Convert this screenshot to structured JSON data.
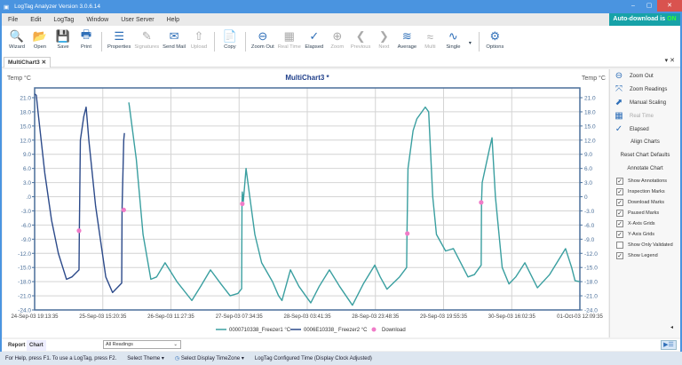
{
  "window": {
    "title": "LogTag Analyzer  Version 3.0.6.14",
    "minimize": "–",
    "maximize": "▢",
    "close": "✕"
  },
  "menu": [
    "File",
    "Edit",
    "LogTag",
    "Window",
    "User Server",
    "Help"
  ],
  "auto_download": {
    "label": "Auto-download is",
    "state": "ON"
  },
  "toolbar": [
    {
      "label": "Wizard",
      "icon": "wizard-icon",
      "glyph": "🔍",
      "enabled": true
    },
    {
      "label": "Open",
      "icon": "folder-open-icon",
      "glyph": "📂",
      "enabled": true
    },
    {
      "label": "Save",
      "icon": "save-icon",
      "glyph": "💾",
      "enabled": true
    },
    {
      "label": "Print",
      "icon": "printer-icon",
      "glyph": "🖶",
      "enabled": true
    },
    {
      "sep": true
    },
    {
      "label": "Properties",
      "icon": "properties-icon",
      "glyph": "☰",
      "enabled": true
    },
    {
      "label": "Signatures",
      "icon": "signature-icon",
      "glyph": "✎",
      "enabled": false
    },
    {
      "label": "Send Mail",
      "icon": "mail-icon",
      "glyph": "✉",
      "enabled": true
    },
    {
      "label": "Upload",
      "icon": "upload-icon",
      "glyph": "⇧",
      "enabled": false
    },
    {
      "sep": true
    },
    {
      "label": "Copy",
      "icon": "copy-icon",
      "glyph": "📄",
      "enabled": true
    },
    {
      "sep": true
    },
    {
      "label": "Zoom Out",
      "icon": "zoom-out-icon",
      "glyph": "⊖",
      "enabled": true
    },
    {
      "label": "Real Time",
      "icon": "calendar-icon",
      "glyph": "▦",
      "enabled": false
    },
    {
      "label": "Elapsed",
      "icon": "elapsed-icon",
      "glyph": "✓",
      "enabled": true
    },
    {
      "label": "Zoom",
      "icon": "zoom-in-icon",
      "glyph": "⊕",
      "enabled": false
    },
    {
      "label": "Previous",
      "icon": "previous-icon",
      "glyph": "❮",
      "enabled": false
    },
    {
      "label": "Next",
      "icon": "next-icon",
      "glyph": "❯",
      "enabled": false
    },
    {
      "label": "Average",
      "icon": "average-chart-icon",
      "glyph": "≋",
      "enabled": true
    },
    {
      "label": "Multi",
      "icon": "multi-chart-icon",
      "glyph": "≈",
      "enabled": false
    },
    {
      "label": "Single",
      "icon": "single-chart-icon",
      "glyph": "∿",
      "enabled": true
    },
    {
      "label": "▾",
      "icon": "dropdown-icon",
      "glyph": "",
      "enabled": true
    },
    {
      "sep": true
    },
    {
      "label": "Options",
      "icon": "gear-icon",
      "glyph": "⚙",
      "enabled": true
    }
  ],
  "doc_tab": {
    "label": "MultiChart3",
    "close": "✕"
  },
  "tab_controls": "▾ ✕",
  "right_panel": {
    "buttons": [
      {
        "label": "Zoom Out",
        "icon": "zoom-out-icon",
        "glyph": "⊖",
        "enabled": true
      },
      {
        "label": "Zoom Readings",
        "icon": "zoom-readings-icon",
        "glyph": "⤧",
        "enabled": true
      },
      {
        "label": "Manual Scaling",
        "icon": "manual-scaling-icon",
        "glyph": "⬈",
        "enabled": true
      },
      {
        "label": "Real Time",
        "icon": "calendar-icon",
        "glyph": "▦",
        "enabled": false
      },
      {
        "label": "Elapsed",
        "icon": "elapsed-icon",
        "glyph": "✓",
        "enabled": true
      }
    ],
    "actions": [
      "Align Charts",
      "Reset Chart Defaults",
      "Annotate Chart"
    ],
    "checkboxes": [
      {
        "label": "Show Annotations",
        "checked": true
      },
      {
        "label": "Inspection Marks",
        "checked": true
      },
      {
        "label": "Download Marks",
        "checked": true
      },
      {
        "label": "Paused Marks",
        "checked": true
      },
      {
        "label": "X-Axis Grids",
        "checked": true
      },
      {
        "label": "Y-Axis Grids",
        "checked": true
      },
      {
        "label": "Show Only Validated",
        "checked": false
      },
      {
        "label": "Show Legend",
        "checked": true
      }
    ],
    "collapse": "◂"
  },
  "bottom": {
    "tabs": [
      "Report",
      "Chart"
    ],
    "readings_select": "All Readings",
    "select_arrow": "⌄",
    "expand": "▶☰"
  },
  "status": [
    "For Help, press F1. To use a LogTag, press F2.",
    "Select Theme  ▾",
    "Select Display TimeZone  ▾",
    "LogTag Configured Time (Display Clock Adjusted)"
  ],
  "colors": {
    "series1": "#3a9fa0",
    "series2": "#2c4a8a",
    "download": "#f07cc8",
    "axis": "#4a6f9a",
    "grid": "#d4d4d4"
  },
  "chart_data": {
    "type": "line",
    "title": "MultiChart3 *",
    "ylabel": "Temp °C",
    "ylabel_right": "Temp °C",
    "ylim": [
      -24,
      21.9
    ],
    "yticks": [
      21,
      18,
      15,
      12,
      9,
      6,
      3,
      0,
      -3,
      -6,
      -9,
      -12,
      -15,
      -18,
      -21,
      -24
    ],
    "ytick_labels": [
      "21.0",
      "18.0",
      "15.0",
      "12.0",
      "9.0",
      "6.0",
      "3.0",
      ".0",
      "-3.0",
      "-6.0",
      "-9.0",
      "-12.0",
      "-15.0",
      "-18.0",
      "-21.0",
      "-24.0"
    ],
    "ytick_labels_right": [
      "21.0",
      "18.0",
      "15.0",
      "12.0",
      "9.0",
      "6.0",
      "3.0",
      "0",
      "-3.0",
      "-6.0",
      "-9.0",
      "-12.0",
      "-15.0",
      "-18.0",
      "-21.0",
      "-24.0"
    ],
    "xunit": "hours since 24-Sep-03 19:13:35",
    "xlim": [
      0,
      160.93
    ],
    "xticks": [
      0,
      20.12,
      40.23,
      60.35,
      80.47,
      100.58,
      120.7,
      140.82,
      160.93
    ],
    "xtick_labels": [
      "24-Sep-03 19:13:35",
      "25-Sep-03 15:20:35",
      "26-Sep-03 11:27:35",
      "27-Sep-03 07:34:35",
      "28-Sep-03 03:41:35",
      "28-Sep-03 23:48:35",
      "29-Sep-03 19:55:35",
      "30-Sep-03 16:02:35",
      "01-Oct-03 12:09:35"
    ],
    "series": [
      {
        "name": "0000710338_Freezer1 °C",
        "points": [
          [
            27.8,
            20
          ],
          [
            28,
            19
          ],
          [
            30,
            8
          ],
          [
            32,
            -8
          ],
          [
            34.3,
            -17.5
          ],
          [
            36,
            -17
          ],
          [
            38.5,
            -14
          ],
          [
            42,
            -18
          ],
          [
            46.4,
            -22
          ],
          [
            49,
            -19
          ],
          [
            51.9,
            -15.5
          ],
          [
            55,
            -18.5
          ],
          [
            57.7,
            -21
          ],
          [
            60,
            -20.5
          ],
          [
            61.1,
            -19.5
          ],
          [
            61.2,
            -1.5
          ],
          [
            61.3,
            1
          ],
          [
            61.6,
            -1
          ],
          [
            62.4,
            6
          ],
          [
            63.5,
            0
          ],
          [
            65,
            -8
          ],
          [
            67,
            -14
          ],
          [
            70.2,
            -18
          ],
          [
            72,
            -21
          ],
          [
            73,
            -22
          ],
          [
            75.5,
            -15.5
          ],
          [
            78,
            -19
          ],
          [
            81.5,
            -22.5
          ],
          [
            84,
            -19
          ],
          [
            87,
            -15.5
          ],
          [
            90,
            -19
          ],
          [
            93.8,
            -23
          ],
          [
            97,
            -18.5
          ],
          [
            100.4,
            -14.5
          ],
          [
            102,
            -17
          ],
          [
            104,
            -19.6
          ],
          [
            107.7,
            -17
          ],
          [
            109.8,
            -15
          ],
          [
            109.9,
            -7.8
          ],
          [
            110.2,
            6
          ],
          [
            111.7,
            14
          ],
          [
            112.8,
            16.5
          ],
          [
            115.3,
            19
          ],
          [
            116.3,
            18
          ],
          [
            117.5,
            0
          ],
          [
            118.6,
            -8
          ],
          [
            121.3,
            -11.5
          ],
          [
            123.6,
            -11
          ],
          [
            127.9,
            -17
          ],
          [
            129.8,
            -16.5
          ],
          [
            131.8,
            -14.5
          ],
          [
            131.9,
            -1.2
          ],
          [
            132.1,
            3
          ],
          [
            134.2,
            10
          ],
          [
            135,
            12.5
          ],
          [
            136,
            0
          ],
          [
            138,
            -15
          ],
          [
            140,
            -18.5
          ],
          [
            142,
            -17
          ],
          [
            144.7,
            -14
          ],
          [
            148.4,
            -19.3
          ],
          [
            152,
            -16.5
          ],
          [
            156.7,
            -11
          ],
          [
            158.5,
            -15
          ],
          [
            159.5,
            -17.8
          ],
          [
            160.9,
            -18
          ]
        ]
      },
      {
        "name": "0006E10338_ Freezer2 °C",
        "points": [
          [
            0,
            21.8
          ],
          [
            0.5,
            21.5
          ],
          [
            1,
            18
          ],
          [
            3,
            5
          ],
          [
            5,
            -5
          ],
          [
            7,
            -12
          ],
          [
            9.4,
            -17.5
          ],
          [
            11,
            -17
          ],
          [
            13.1,
            -15.5
          ],
          [
            13.2,
            -7.2
          ],
          [
            13.5,
            12
          ],
          [
            14.5,
            17
          ],
          [
            15.2,
            19
          ],
          [
            16,
            12
          ],
          [
            18,
            -2
          ],
          [
            20,
            -12
          ],
          [
            21,
            -17
          ],
          [
            23,
            -20.3
          ],
          [
            25.7,
            -18.3
          ],
          [
            25.8,
            -2.8
          ],
          [
            26.3,
            12
          ],
          [
            26.5,
            13.5
          ]
        ]
      }
    ],
    "download_marks": [
      [
        13.1,
        -7.2
      ],
      [
        26.3,
        -2.8
      ],
      [
        61.3,
        -1.5
      ],
      [
        110,
        -7.8
      ],
      [
        131.8,
        -1.2
      ]
    ],
    "legend": {
      "placement": "bottom",
      "entries": [
        "0000710338_Freezer1 °C",
        "0006E10338_ Freezer2 °C",
        "Download"
      ]
    },
    "grid": {
      "x": true,
      "y": true
    }
  }
}
